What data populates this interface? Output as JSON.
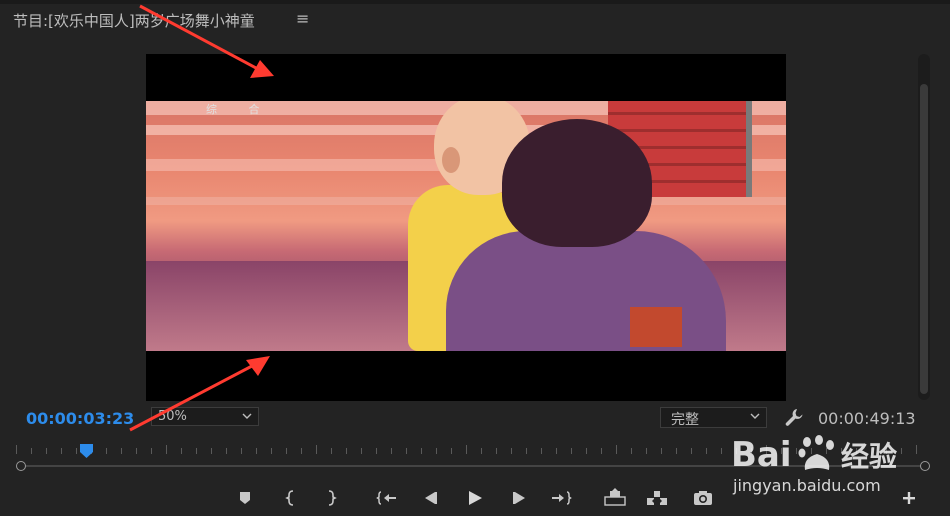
{
  "panel": {
    "title": "节目:[欢乐中国人]两岁广场舞小神童",
    "menu_glyph": "≡"
  },
  "video": {
    "caption": "综 合"
  },
  "controls": {
    "current_timecode": "00:00:03:23",
    "zoom_value": "50%",
    "quality_value": "完整",
    "total_timecode": "00:00:49:13"
  },
  "icons": {
    "marker": "add-marker-icon",
    "mark_in": "mark-in-icon",
    "mark_out": "mark-out-icon",
    "go_to_in": "go-to-in-icon",
    "step_back": "step-back-icon",
    "play": "play-icon",
    "step_forward": "step-forward-icon",
    "go_to_out": "go-to-out-icon",
    "lift": "lift-icon",
    "extract": "extract-icon",
    "export_frame": "camera-icon",
    "button_editor": "plus-icon",
    "settings": "wrench-icon"
  },
  "watermark": {
    "logo": "Bai",
    "logo_rest": "经验",
    "site": "jingyan.baidu.com"
  },
  "colors": {
    "accent": "#2d8ceb",
    "annotation": "#ff3b30"
  }
}
